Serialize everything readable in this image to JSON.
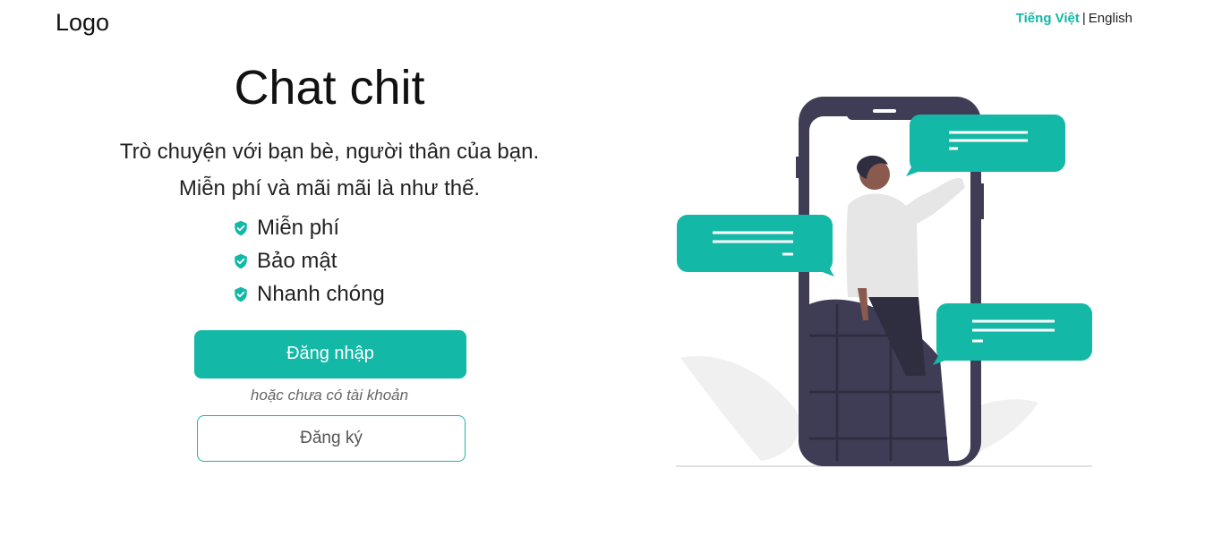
{
  "header": {
    "logo": "Logo",
    "lang_vi": "Tiếng Việt",
    "lang_sep": "|",
    "lang_en": "English"
  },
  "hero": {
    "title": "Chat chit",
    "subtitle": "Trò chuyện với bạn bè, người thân của bạn. Miễn phí và mãi mãi là như thế.",
    "features": [
      "Miễn phí",
      "Bảo mật",
      "Nhanh chóng"
    ],
    "login_label": "Đăng nhập",
    "or_text": "hoặc chưa có tài khoản",
    "register_label": "Đăng ký"
  },
  "colors": {
    "accent": "#14b8a6",
    "phone": "#3f3d56",
    "bubble": "#14b8a6"
  },
  "icons": {
    "feature_icon": "shield-check-icon",
    "illustration": "person-phone-chat-illustration"
  }
}
